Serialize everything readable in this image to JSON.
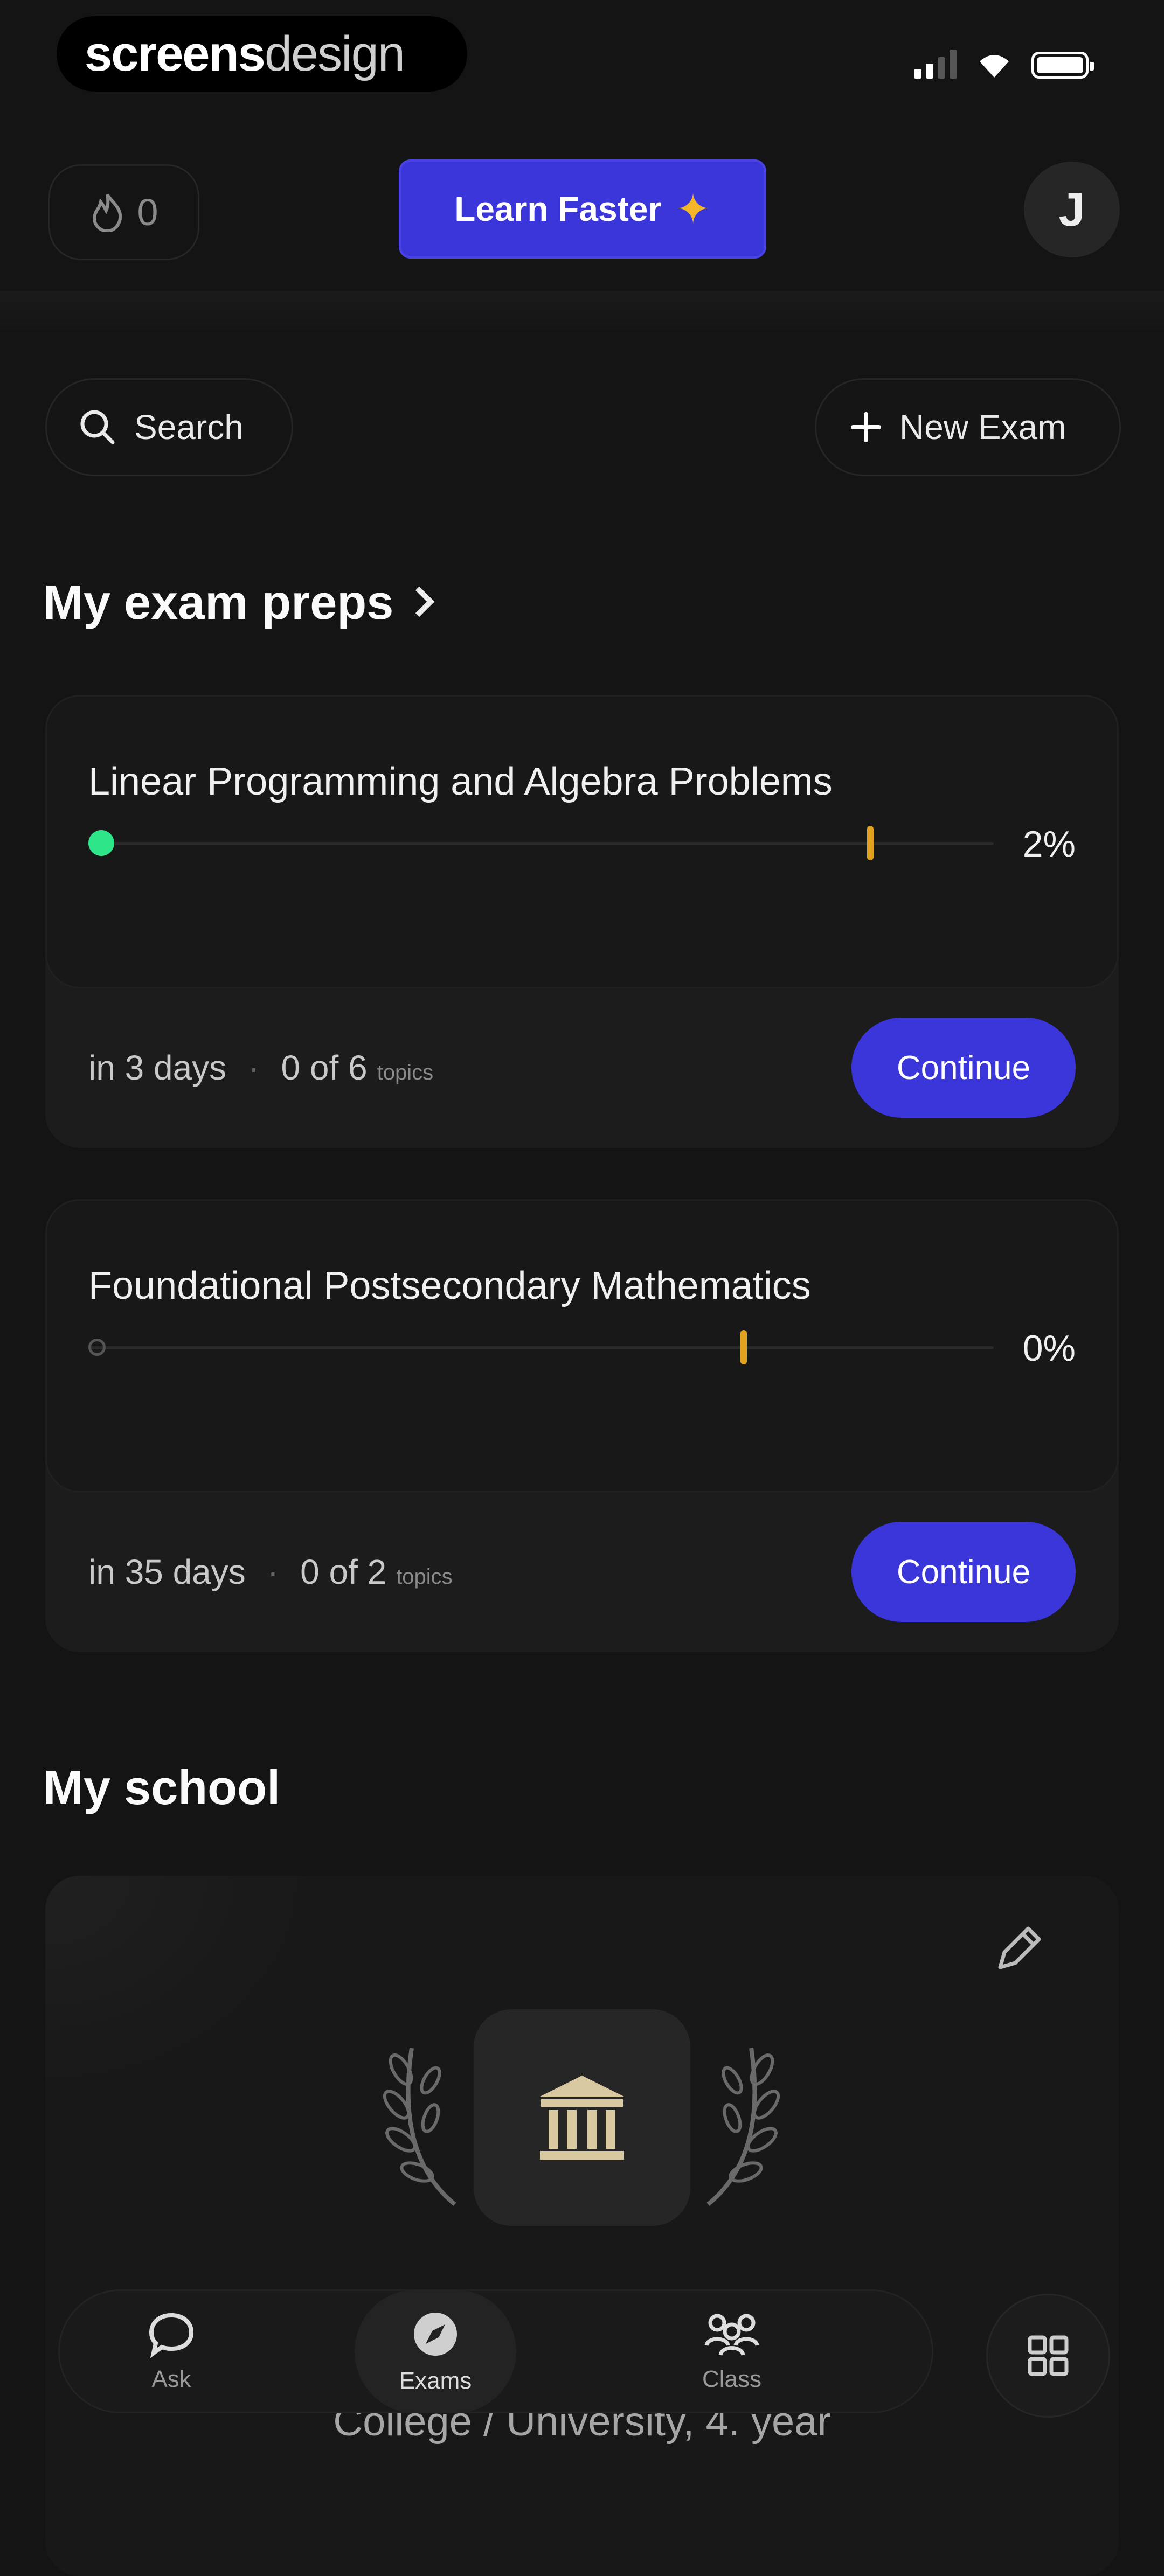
{
  "status_bar": {
    "brand_part1": "screens",
    "brand_part2": "design"
  },
  "header": {
    "streak_count": "0",
    "learn_faster_label": "Learn Faster",
    "avatar_initial": "J"
  },
  "actions": {
    "search_label": "Search",
    "new_exam_label": "New Exam"
  },
  "exam_preps": {
    "section_title": "My exam preps",
    "items": [
      {
        "title": "Linear Programming and Algebra Problems",
        "progress_percent": 2,
        "progress_label": "2%",
        "target_marker_fraction": 0.86,
        "due": "in 3 days",
        "topics_count": "0 of 6",
        "topics_word": "topics",
        "button_label": "Continue"
      },
      {
        "title": "Foundational Postsecondary Mathematics",
        "progress_percent": 0,
        "progress_label": "0%",
        "target_marker_fraction": 0.72,
        "due": "in 35 days",
        "topics_count": "0 of 2",
        "topics_word": "topics",
        "button_label": "Continue"
      }
    ]
  },
  "school": {
    "section_title": "My school",
    "subtitle": "College / University, 4. year"
  },
  "bottom_nav": {
    "items": [
      {
        "label": "Ask",
        "icon": "chat-bubble-icon"
      },
      {
        "label": "Exams",
        "icon": "compass-icon"
      },
      {
        "label": "Class",
        "icon": "people-icon"
      }
    ],
    "grid_icon": "grid-icon"
  },
  "colors": {
    "background": "#141414",
    "accent": "#3b36d9",
    "progress_green": "#2ee58a",
    "target_marker": "#e1a21e"
  }
}
